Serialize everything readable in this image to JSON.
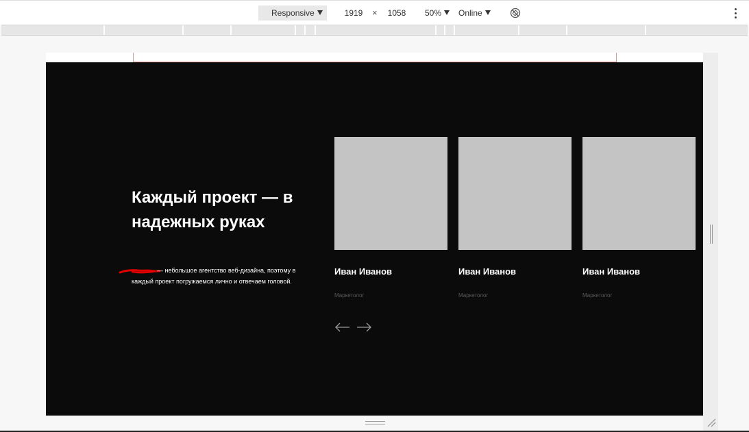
{
  "devtools": {
    "device_mode": "Responsive",
    "width": "1919",
    "times": "×",
    "height": "1058",
    "zoom": "50%",
    "throttling": "Online"
  },
  "page": {
    "title": "Каждый проект — в надежных руках",
    "description": "— небольшое агентство веб-дизайна, поэтому в каждый проект погружаемся лично и отвечаем головой.",
    "team": [
      {
        "name": "Иван Иванов",
        "role": "Маркетолог"
      },
      {
        "name": "Иван Иванов",
        "role": "Маркетолог"
      },
      {
        "name": "Иван Иванов",
        "role": "Маркетолог"
      }
    ]
  },
  "colors": {
    "page_bg": "#0b0b0b",
    "placeholder": "#c4c4c4",
    "text": "#ffffff",
    "muted": "#5a5a5a",
    "redaction": "#e00000"
  },
  "icons": [
    "caret-down-icon",
    "rotate-icon",
    "more-vertical-icon",
    "arrow-left-icon",
    "arrow-right-icon"
  ]
}
